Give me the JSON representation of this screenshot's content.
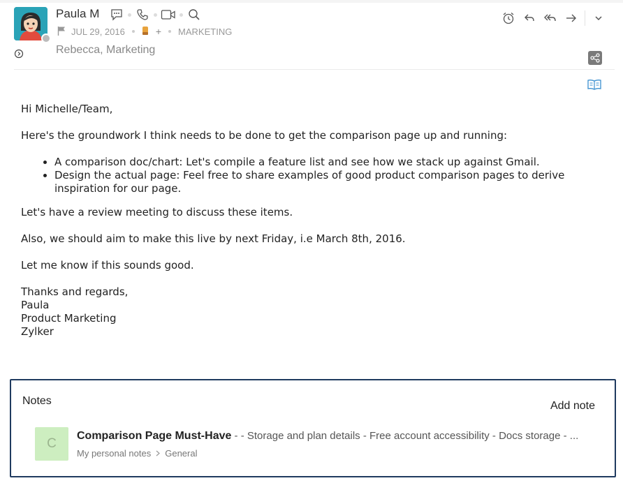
{
  "email": {
    "sender_name": "Paula M",
    "date": "JUL 29, 2016",
    "add_label": "+",
    "folder": "MARKETING",
    "recipients": "Rebecca, Marketing",
    "body": {
      "greeting": "Hi Michelle/Team,",
      "intro": "Here's the groundwork I think needs to be done to get the comparison page up and running:",
      "bullets": [
        "A comparison doc/chart: Let's compile a feature list and see how we stack up against Gmail.",
        "Design the actual page: Feel free to share examples of good product comparison pages to derive inspiration for our page."
      ],
      "para1": "Let's have a review meeting to discuss these items.",
      "para2": "Also, we should aim to make this live by next Friday, i.e March 8th, 2016.",
      "para3": "Let me know if this sounds good.",
      "signature": [
        "Thanks and regards,",
        "Paula",
        "Product Marketing",
        "Zylker"
      ]
    }
  },
  "icons": {
    "quick": [
      "chat-icon",
      "phone-icon",
      "video-icon",
      "search-icon"
    ],
    "actions": [
      "reminder-icon",
      "reply-icon",
      "reply-all-icon",
      "forward-icon",
      "more-icon"
    ],
    "flag": "flag-icon",
    "tag_color": "#e8a33d"
  },
  "notes": {
    "title": "Notes",
    "add_label": "Add note",
    "items": [
      {
        "avatar_letter": "C",
        "title": "Comparison Page Must-Have",
        "snippet": " - - Storage and plan details  - Free account accessibility  - Docs storage  - ...",
        "notebook": "My personal notes",
        "section": "General"
      }
    ]
  },
  "colors": {
    "notes_border": "#1f3a5f",
    "avatar_bg": "#2aa3b7",
    "note_avatar_bg": "#cdeec0",
    "reader_icon": "#3a8fd0"
  }
}
